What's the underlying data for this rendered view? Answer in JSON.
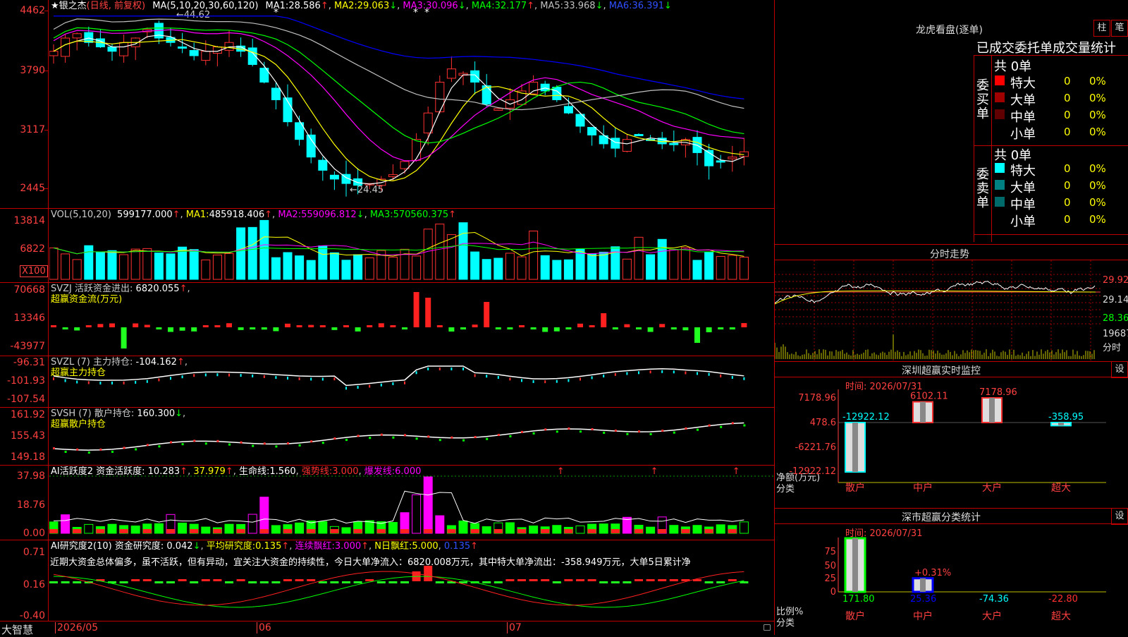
{
  "app_name": "大智慧",
  "main": {
    "star": "★",
    "stock_name": "银之杰",
    "period": "(日线, 前复权)",
    "ma_params": "MA(5,10,20,30,60,120)",
    "ma1_label": "MA1:",
    "ma1": "28.586",
    "ma2_label": "MA2:",
    "ma2": "29.063",
    "ma3_label": "MA3:",
    "ma3": "30.096",
    "ma4_label": "MA4:",
    "ma4": "32.177",
    "ma5_label": "MA5:",
    "ma5": "33.968",
    "ma6_label": "MA6:",
    "ma6": "36.391",
    "high_mark": "44.62",
    "low_mark": "24.45",
    "yticks": [
      "4462",
      "3790",
      "3117",
      "2445"
    ]
  },
  "vol": {
    "header": "VOL(5,10,20)",
    "value": "599177.000",
    "ma1_label": "MA1:",
    "ma1": "485918.406",
    "ma2_label": "MA2:",
    "ma2": "559096.812",
    "ma3_label": "MA3:",
    "ma3": "570560.375",
    "yticks": [
      "13814",
      "6822"
    ],
    "unit": "X100"
  },
  "svzj": {
    "header": "SVZJ  活跃资金进出:",
    "value": "6820.055",
    "subtitle": "超赢资金流(万元)",
    "yticks": [
      "70668",
      "13346",
      "-43977"
    ]
  },
  "svzl": {
    "header": "SVZL (7) 主力持仓:",
    "value": "-104.162",
    "subtitle": "超赢主力持仓",
    "yticks": [
      "-96.31",
      "-101.93",
      "-107.54"
    ]
  },
  "svsh": {
    "header": "SVSH (7) 散户持仓:",
    "value": "160.300",
    "subtitle": "超赢散户持仓",
    "yticks": [
      "161.92",
      "155.43",
      "149.18"
    ]
  },
  "ai_active": {
    "header": "AI活跃度2 资金活跃度:",
    "value1": "10.283",
    "value2": "37.979",
    "life_label": "生命线:",
    "life": "1.560",
    "strong_label": "强势线:",
    "strong": "3.000",
    "burst_label": "爆发线:",
    "burst": "6.000",
    "yticks": [
      "37.98",
      "18.76",
      "0.00"
    ]
  },
  "ai_research": {
    "header": "AI研究度2(10) 资金研究度:",
    "value": "0.042",
    "avg_label": "平均研究度:",
    "avg": "0.135",
    "cont_label": "连续飘红:",
    "cont": "3.000",
    "n_label": "N日飘红:",
    "n": "5.000",
    "extra": "0.135",
    "commentary": "近期大资金总体偏多，虽不活跃，但有异动，宜关注大资金的持续性，今日大单净流入：6820.008万元，其中特大单净流出：-358.949万元，大单5日累计净",
    "yticks": [
      "0.71",
      "0.16",
      "-0.40"
    ]
  },
  "dates": [
    "2026/05",
    "06",
    "07"
  ],
  "lhb": {
    "title": "龙虎看盘(逐单)",
    "btn1": "柱",
    "btn2": "笔",
    "subtitle": "已成交委托单成交量统计",
    "buy_label": "委买单",
    "sell_label": "委卖单",
    "buy_total": "共 0单",
    "sell_total": "共 0单",
    "buy_rows": [
      {
        "name": "特大",
        "count": "0",
        "pct": "0%",
        "color": "#ff0000"
      },
      {
        "name": "大单",
        "count": "0",
        "pct": "0%",
        "color": "#a00000"
      },
      {
        "name": "中单",
        "count": "0",
        "pct": "0%",
        "color": "#600000"
      },
      {
        "name": "小单",
        "count": "0",
        "pct": "0%",
        "color": "#000000"
      }
    ],
    "sell_rows": [
      {
        "name": "特大",
        "count": "0",
        "pct": "0%",
        "color": "#00ffff"
      },
      {
        "name": "大单",
        "count": "0",
        "pct": "0%",
        "color": "#008080"
      },
      {
        "name": "中单",
        "count": "0",
        "pct": "0%",
        "color": "#006a6a"
      },
      {
        "name": "小单",
        "count": "0",
        "pct": "0%",
        "color": "#000000"
      }
    ]
  },
  "intraday": {
    "title": "分时走势",
    "prices": [
      "29.92",
      "29.14",
      "28.36"
    ],
    "vol_label": "19687",
    "vol_unit": "分时"
  },
  "sz_monitor": {
    "title": "深圳超赢实时监控",
    "btn": "设",
    "time_label": "时间:",
    "time": "2026/07/31",
    "yticks": [
      "7178.96",
      "478.6",
      "-6221.76",
      "-12922.12"
    ],
    "bar_values": [
      "-12922.12",
      "6102.11",
      "7178.96",
      "-358.95"
    ],
    "ylabel": "净额(万元)",
    "xlabel": "分类",
    "categories": [
      "散户",
      "中户",
      "大户",
      "超大"
    ]
  },
  "sz_class": {
    "title": "深市超赢分类统计",
    "btn": "设",
    "time_label": "时间:",
    "time": "2026/07/31",
    "yticks": [
      "75",
      "50",
      "25",
      "0"
    ],
    "annot": "+0.31%",
    "values": [
      "171.80",
      "25.36",
      "-74.36",
      "-22.80"
    ],
    "ylabel": "比例%",
    "xlabel": "分类",
    "categories": [
      "散户",
      "中户",
      "大户",
      "超大"
    ]
  },
  "colors": {
    "up": "#ff3030",
    "down": "#00ffff",
    "grid": "#c00000",
    "ma1": "#ffffff",
    "ma2": "#ffff00",
    "ma3": "#ff00ff",
    "ma4": "#00ff00",
    "ma5": "#c0c0c0",
    "ma6": "#0000ff"
  }
}
